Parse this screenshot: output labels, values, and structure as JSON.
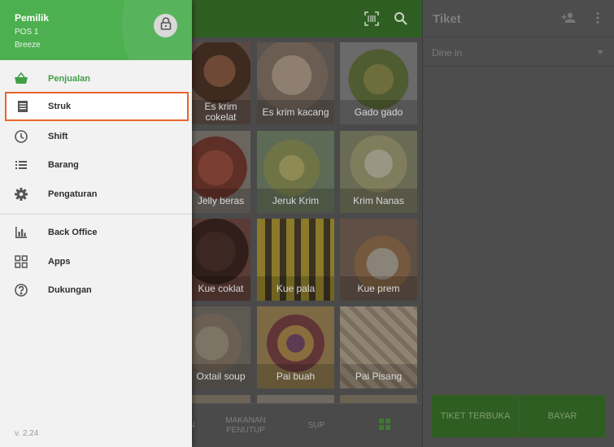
{
  "drawer": {
    "owner": "Pemilik",
    "pos": "POS 1",
    "store": "Breeze",
    "lock_icon": "lock-icon",
    "items": [
      {
        "label": "Penjualan",
        "icon": "basket-icon",
        "active": true
      },
      {
        "label": "Struk",
        "icon": "receipt-icon",
        "highlighted": true
      },
      {
        "label": "Shift",
        "icon": "clock-icon"
      },
      {
        "label": "Barang",
        "icon": "list-icon"
      },
      {
        "label": "Pengaturan",
        "icon": "gear-icon"
      },
      {
        "label": "Back Office",
        "icon": "bar-chart-icon"
      },
      {
        "label": "Apps",
        "icon": "apps-icon"
      },
      {
        "label": "Dukungan",
        "icon": "help-icon"
      }
    ],
    "version": "v. 2.24"
  },
  "products": [
    {
      "name": "Es krim cokelat",
      "partial": true
    },
    {
      "name": "Es krim kacang"
    },
    {
      "name": "Gado gado"
    },
    {
      "name": "Jelly beras",
      "partial": true
    },
    {
      "name": "Jeruk Krim"
    },
    {
      "name": "Krim Nanas"
    },
    {
      "name": "Kue coklat",
      "partial": true
    },
    {
      "name": "Kue pala"
    },
    {
      "name": "Kue prem"
    },
    {
      "name": "Oxtail soup",
      "partial": true
    },
    {
      "name": "Pai buah"
    },
    {
      "name": "Pai Pisang"
    }
  ],
  "bottom_tabs": {
    "tab1_partial": "N",
    "tab2": "MAKANAN PENUTUP",
    "tab3": "SUP",
    "grid_icon": "grid-icon"
  },
  "toolbar": {
    "barcode_icon": "barcode-scan-icon",
    "search_icon": "search-icon"
  },
  "ticket": {
    "title": "Tiket",
    "add_customer_icon": "add-person-icon",
    "menu_icon": "more-vert-icon",
    "dine_option": "Dine in",
    "open_ticket_label": "TIKET TERBUKA",
    "pay_label": "BAYAR"
  },
  "colors": {
    "brand_green": "#4caf50",
    "highlight_outline": "#e8652c"
  }
}
